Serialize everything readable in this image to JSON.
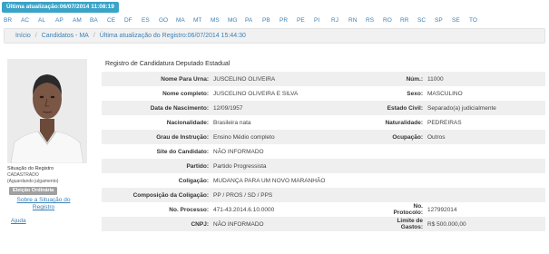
{
  "top_badge": "Última atualização:06/07/2014 11:08:19",
  "states": [
    "BR",
    "AC",
    "AL",
    "AP",
    "AM",
    "BA",
    "CE",
    "DF",
    "ES",
    "GO",
    "MA",
    "MT",
    "MS",
    "MG",
    "PA",
    "PB",
    "PR",
    "PE",
    "PI",
    "RJ",
    "RN",
    "RS",
    "RO",
    "RR",
    "SC",
    "SP",
    "SE",
    "TO"
  ],
  "breadcrumb": {
    "home": "Início",
    "candidates": "Candidatos - MA",
    "updated": "Última atualização do Registro:06/07/2014 15:44:30"
  },
  "sidebar": {
    "status_label": "Situação do Registro",
    "status_value": "CADASTRADO",
    "status_sub": "(Aguardando julgamento)",
    "election_badge": "Eleição Ordinária",
    "about_link": "Sobre a Situação do Registro",
    "help_link": "Ajuda"
  },
  "section_title": "Registro de Candidatura Deputado Estadual",
  "fields": {
    "nome_urna_label": "Nome Para Urna:",
    "nome_urna": "JUSCELINO OLIVEIRA",
    "num_label": "Núm.:",
    "num": "11000",
    "nome_completo_label": "Nome completo:",
    "nome_completo": "JUSCELINO OLIVEIRA E SILVA",
    "sexo_label": "Sexo:",
    "sexo": "MASCULINO",
    "nascimento_label": "Data de Nascimento:",
    "nascimento": "12/09/1957",
    "estado_civil_label": "Estado Civil:",
    "estado_civil": "Separado(a) judicialmente",
    "nacionalidade_label": "Nacionalidade:",
    "nacionalidade": "Brasileira nata",
    "naturalidade_label": "Naturalidade:",
    "naturalidade": "PEDREIRAS",
    "instrucao_label": "Grau de Instrução:",
    "instrucao": "Ensino Médio completo",
    "ocupacao_label": "Ocupação:",
    "ocupacao": "Outros",
    "site_label": "Site do Candidato:",
    "site": "NÃO INFORMADO",
    "partido_label": "Partido:",
    "partido": "Partido Progressista",
    "coligacao_label": "Coligação:",
    "coligacao": "MUDANÇA PARA UM NOVO MARANHÃO",
    "composicao_label": "Composição da Coligação:",
    "composicao": "PP / PROS / SD / PPS",
    "processo_label": "No. Processo:",
    "processo": "471-43.2014.6.10.0000",
    "protocolo_label": "No. Protocolo:",
    "protocolo": "127992014",
    "cnpj_label": "CNPJ:",
    "cnpj": "NÃO INFORMADO",
    "limite_label": "Limite de Gastos:",
    "limite": "R$ 500.000,00"
  }
}
